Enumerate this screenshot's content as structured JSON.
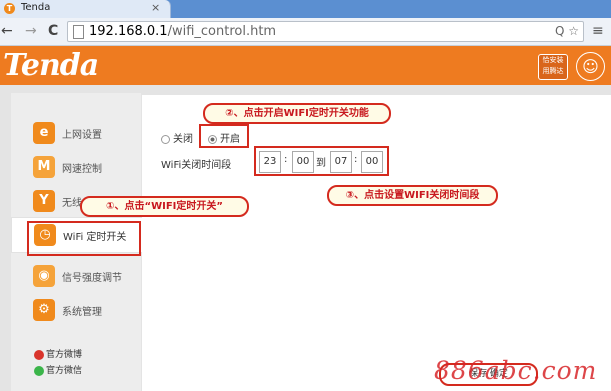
{
  "browser": {
    "tab_title": "Tenda",
    "tab_close": "×",
    "url_host": "192.168.0.1",
    "url_path": "/wifi_control.htm",
    "url_icons": "Q ☆",
    "back": "←",
    "forward": "→",
    "reload": "C",
    "menu": "≡"
  },
  "header": {
    "logo": "Tenda",
    "badge": "恰安装 用腾达",
    "circle": "☺"
  },
  "sidebar": {
    "items": [
      {
        "label": "上网设置",
        "icon": "e"
      },
      {
        "label": "网速控制",
        "icon": "M"
      },
      {
        "label": "无线",
        "icon": "Y"
      },
      {
        "label": "WiFi 定时开关",
        "icon": "◷"
      },
      {
        "label": "信号强度调节",
        "icon": "◉"
      },
      {
        "label": "系统管理",
        "icon": "⚙"
      }
    ],
    "social": [
      {
        "label": "官方微博"
      },
      {
        "label": "官方微信"
      }
    ]
  },
  "wifi_control": {
    "option_off": "关闭",
    "option_on": "开启",
    "period_label": "WiFi关闭时间段",
    "start_hour": "23",
    "start_min": "00",
    "to": "到",
    "end_hour": "07",
    "end_min": "00",
    "colon": ":"
  },
  "callouts": {
    "step1": "①、点击“WIFI定时开关”",
    "step2": "②、点击开启WIFI定时开关功能",
    "step3": "③、点击设置WIFI关闭时间段"
  },
  "bottom": {
    "save_button": "保存  确定"
  },
  "watermark": "886abc.com",
  "colors": {
    "brand_orange": "#ee7b20",
    "highlight_red": "#d42a1e"
  }
}
